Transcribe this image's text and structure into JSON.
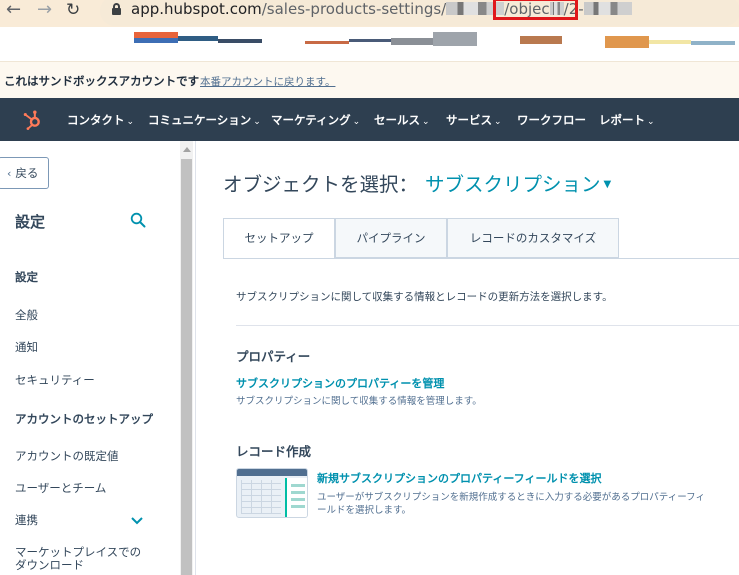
{
  "browser": {
    "url_host": "app.hubspot.com",
    "url_path": "/sales-products-settings/",
    "url_path_mid": "/objec",
    "url_path_end": "/2-",
    "icons": [
      "back-arrow-icon",
      "forward-arrow-icon",
      "reload-icon",
      "lock-icon"
    ]
  },
  "sandbox_banner": {
    "text": "これはサンドボックスアカウントです",
    "link": "本番アカウントに戻ります。"
  },
  "topnav": {
    "items": [
      {
        "label": "コンタクト",
        "has_menu": true
      },
      {
        "label": "コミュニケーション",
        "has_menu": true
      },
      {
        "label": "マーケティング",
        "has_menu": true
      },
      {
        "label": "セールス",
        "has_menu": true
      },
      {
        "label": "サービス",
        "has_menu": true
      },
      {
        "label": "ワークフロー",
        "has_menu": false
      },
      {
        "label": "レポート",
        "has_menu": true
      }
    ],
    "chevron": "⌄"
  },
  "sidebar": {
    "back_label": "戻る",
    "title": "設定",
    "section_settings": "設定",
    "items": [
      "全般",
      "通知",
      "セキュリティー"
    ],
    "section_account": "アカウントのセットアップ",
    "account_items": [
      "アカウントの既定値",
      "ユーザーとチーム",
      "連携"
    ],
    "marketplace_line1": "マーケットプレイスでの",
    "marketplace_line2": "ダウンロード"
  },
  "main": {
    "title": "オブジェクトを選択：",
    "object_selected": "サブスクリプション",
    "tabs": [
      "セットアップ",
      "パイプライン",
      "レコードのカスタマイズ"
    ],
    "active_tab": 0,
    "description": "サブスクリプションに関して収集する情報とレコードの更新方法を選択します。",
    "properties": {
      "heading": "プロパティー",
      "link": "サブスクリプションのプロパティーを管理",
      "sub": "サブスクリプションに関して収集する情報を管理します。"
    },
    "record_creation": {
      "heading": "レコード作成",
      "link": "新規サブスクリプションのプロパティーフィールドを選択",
      "sub_line1": "ユーザーがサブスクリプションを新規作成するときに入力する必要があるプロパティーフィ",
      "sub_line2": "ールドを選択します。"
    }
  },
  "colors": {
    "nav_bg": "#2e3f50",
    "accent_link": "#0091ae",
    "logo_orange": "#ff7a59",
    "banner_bg": "#fdf8f0",
    "highlight_box": "#e0171b"
  }
}
